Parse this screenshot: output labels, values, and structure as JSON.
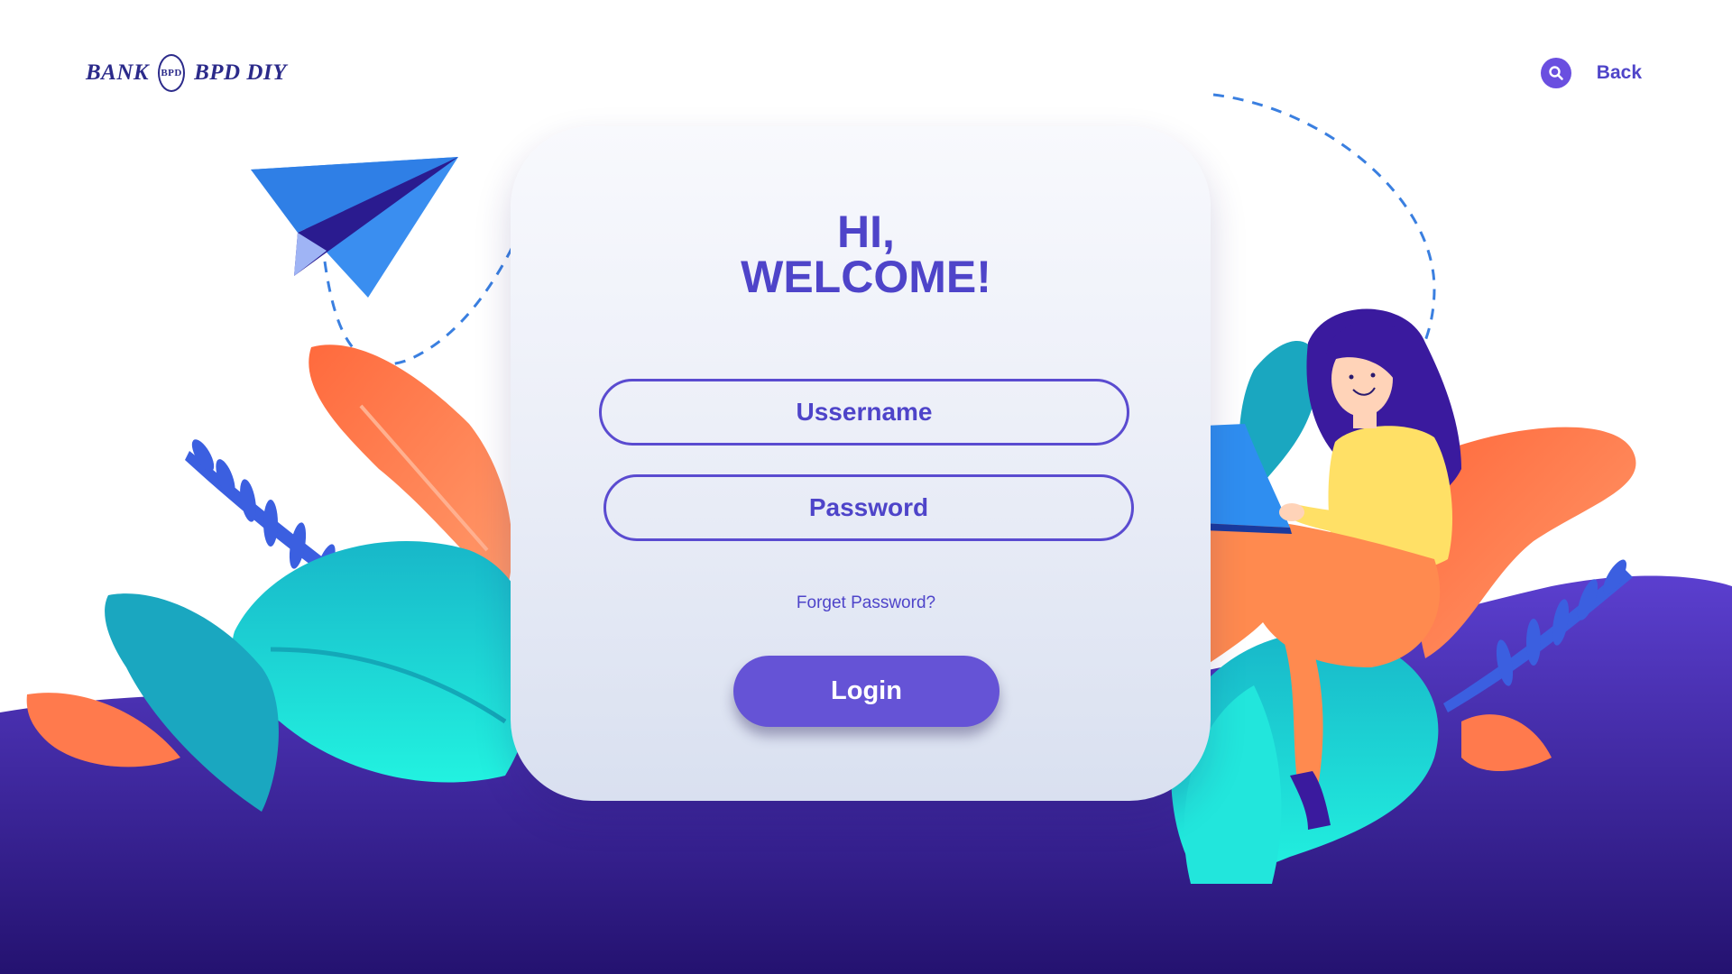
{
  "brand": {
    "logo_left": "BANK",
    "logo_emblem": "BPD",
    "logo_right": "BPD DIY"
  },
  "nav": {
    "search_icon": "search-icon",
    "back_label": "Back"
  },
  "login_card": {
    "greeting_line1": "HI,",
    "greeting_line2": "WELCOME!",
    "username_placeholder": "Ussername",
    "password_placeholder": "Password",
    "forget_password": "Forget Password?",
    "login_button": "Login"
  },
  "colors": {
    "accent": "#6553d6",
    "text_primary": "#4e44c9",
    "ground_top": "#5b3fcf",
    "ground_bottom": "#241270",
    "leaf_cyan": "#1fd8d3",
    "leaf_orange": "#ff7a4d",
    "leaf_blue": "#3a6fe0",
    "paper_plane": "#3a8ef0"
  }
}
